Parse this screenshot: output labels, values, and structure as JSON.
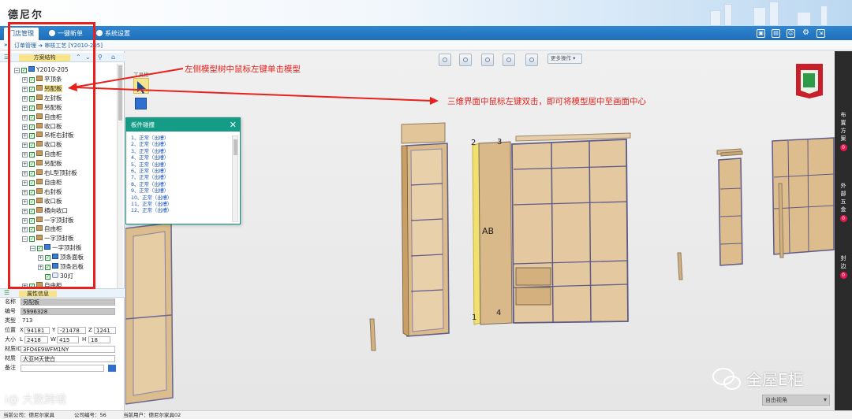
{
  "app": {
    "logo": "德尼尔"
  },
  "menu": {
    "tabs": [
      {
        "label": "门店管理",
        "active": true
      },
      {
        "label": "一键新单",
        "active": false
      },
      {
        "label": "系统设置",
        "active": false
      }
    ]
  },
  "breadcrumb": {
    "arrow": "»",
    "text": "订单管理 ➔ 审核工艺 [Y2010-205]"
  },
  "tree_panel": {
    "title": "方案结构",
    "root": "Y2010-205",
    "items": [
      {
        "label": "平顶条",
        "expand": "+",
        "icon": "board"
      },
      {
        "label": "另配板",
        "expand": "+",
        "icon": "board",
        "selected": true
      },
      {
        "label": "左封板",
        "expand": "+",
        "icon": "board"
      },
      {
        "label": "另配板",
        "expand": "+",
        "icon": "board"
      },
      {
        "label": "自由柜",
        "expand": "+",
        "icon": "board"
      },
      {
        "label": "收口板",
        "expand": "+",
        "icon": "board"
      },
      {
        "label": "吊柜右封板",
        "expand": "+",
        "icon": "board"
      },
      {
        "label": "收口板",
        "expand": "+",
        "icon": "board"
      },
      {
        "label": "自由柜",
        "expand": "+",
        "icon": "board"
      },
      {
        "label": "另配板",
        "expand": "+",
        "icon": "board"
      },
      {
        "label": "右L型顶封板",
        "expand": "+",
        "icon": "board"
      },
      {
        "label": "自由柜",
        "expand": "+",
        "icon": "board"
      },
      {
        "label": "右封板",
        "expand": "+",
        "icon": "board"
      },
      {
        "label": "收口板",
        "expand": "+",
        "icon": "board"
      },
      {
        "label": "横向收口",
        "expand": "+",
        "icon": "board"
      },
      {
        "label": "一字顶封板",
        "expand": "+",
        "icon": "board"
      },
      {
        "label": "自由柜",
        "expand": "+",
        "icon": "board"
      },
      {
        "label": "一字顶封板",
        "expand": "−",
        "icon": "board"
      },
      {
        "label": "一字顶封板",
        "expand": "−",
        "icon": "flag",
        "level": 2
      },
      {
        "label": "顶条面板",
        "expand": "+",
        "icon": "flag",
        "level": 3
      },
      {
        "label": "顶条后板",
        "expand": "+",
        "icon": "flag",
        "level": 3
      },
      {
        "label": "30灯",
        "expand": "",
        "icon": "light",
        "level": 3
      },
      {
        "label": "自由柜",
        "expand": "+",
        "icon": "board"
      }
    ]
  },
  "properties": {
    "title": "属性信息",
    "name_label": "名称",
    "name_value": "另配板",
    "code_label": "编号",
    "code_value": "5996328",
    "type_label": "类型",
    "type_value": "713",
    "pos_label": "位置",
    "pos_x": "94181",
    "pos_y": "-21478",
    "pos_z": "1241",
    "size_label": "大小",
    "size_l": "2418",
    "size_w": "415",
    "size_h": "18",
    "material_id_label": "材质ID",
    "material_id_value": "3FO4E9WFM1NY",
    "material_label": "材质",
    "material_value": "大亚M天使白",
    "note_label": "备注",
    "note_value": "",
    "axis_x": "X",
    "axis_y": "Y",
    "axis_z": "Z",
    "axis_l": "L",
    "axis_w": "W",
    "axis_h": "H"
  },
  "status_bar": {
    "company": "当前公司：德尼尔家具",
    "company_no": "公司编号：56",
    "user": "当前用户：德尼尔家具02"
  },
  "viewport": {
    "more_ops": "更多操作",
    "tool_label": "工具栏",
    "view_select": "自由视角",
    "dim_labels": [
      "2",
      "3",
      "AB",
      "1",
      "4"
    ]
  },
  "dialog": {
    "title": "板件碰撞",
    "close": "✕",
    "items": [
      "1、正常（出槽）",
      "2、正常（出槽）",
      "3、正常（出槽）",
      "4、正常（出槽）",
      "5、正常（出槽）",
      "6、正常（出槽）",
      "7、正常（出槽）",
      "8、正常（出槽）",
      "9、正常（出槽）",
      "10、正常（出槽）",
      "11、正常（出槽）",
      "12、正常（出槽）"
    ]
  },
  "right_sidebar": {
    "items": [
      {
        "label": "布置方案",
        "badge": "0"
      },
      {
        "label": "外部五金",
        "badge": "0"
      },
      {
        "label": "封边",
        "badge": "0"
      }
    ]
  },
  "annotations": {
    "left": "左侧模型树中鼠标左键单击模型",
    "right": "三维界面中鼠标左键双击，即可将模型居中至画面中心"
  },
  "watermarks": {
    "left": "i@ 大数跨境",
    "right": "全屋E柜"
  },
  "colors": {
    "menu_blue": "#1f6fb8",
    "annotation_red": "#e8211d",
    "dialog_teal": "#149c87",
    "highlight_yellow": "#f7e48a",
    "badge_pink": "#e8184f",
    "wood": "#d9b98a"
  }
}
